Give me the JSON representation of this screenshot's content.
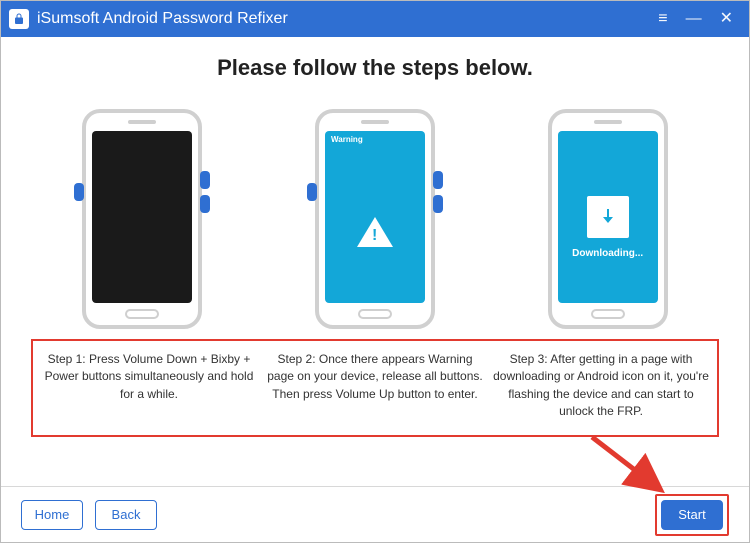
{
  "titlebar": {
    "app_name": "iSumsoft Android Password Refixer"
  },
  "headline": "Please follow the steps below.",
  "steps": [
    {
      "screen_type": "black",
      "desc": "Step 1: Press Volume Down + Bixby + Power buttons simultaneously and hold for a while."
    },
    {
      "screen_type": "warning",
      "warning_label": "Warning",
      "desc": "Step 2: Once there appears Warning page on your device, release all buttons. Then press Volume Up button to enter."
    },
    {
      "screen_type": "downloading",
      "downloading_label": "Downloading...",
      "desc": "Step 3: After getting in a page with downloading or Android icon on it, you're flashing the device and can start to unlock the FRP."
    }
  ],
  "footer": {
    "home": "Home",
    "back": "Back",
    "start": "Start"
  }
}
